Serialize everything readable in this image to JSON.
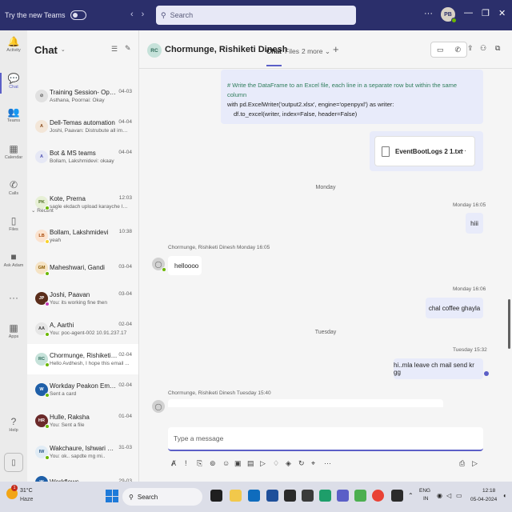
{
  "titlebar": {
    "try_label": "Try the new Teams",
    "search_placeholder": "Search",
    "more": "···",
    "user_initials": "PB"
  },
  "rail": [
    {
      "label": "Activity",
      "icon": "bell-icon",
      "glyph": "🔔"
    },
    {
      "label": "Chat",
      "icon": "chat-icon",
      "glyph": "💬",
      "active": true
    },
    {
      "label": "Teams",
      "icon": "teams-icon",
      "glyph": "👥"
    },
    {
      "label": "Calendar",
      "icon": "calendar-icon",
      "glyph": "▦"
    },
    {
      "label": "Calls",
      "icon": "phone-icon",
      "glyph": "✆"
    },
    {
      "label": "Files",
      "icon": "file-icon",
      "glyph": "▯"
    },
    {
      "label": "Ask Adam",
      "icon": "bot-icon",
      "glyph": "■"
    },
    {
      "label": "",
      "icon": "more-icon",
      "glyph": "···"
    },
    {
      "label": "Apps",
      "icon": "apps-icon",
      "glyph": "▦"
    },
    {
      "label": "Help",
      "icon": "help-icon",
      "glyph": "?"
    }
  ],
  "chatlist": {
    "title": "Chat",
    "recent_label": "Recent",
    "items": [
      {
        "initials": "⊘",
        "name": "Training Session- OpenCV",
        "time": "04-03",
        "preview": "Asthana, Poornai: Okay",
        "avatar_bg": "#e1e1e1",
        "avatar_fg": "#616161",
        "status": ""
      },
      {
        "initials": "A",
        "name": "Dell-Temas automation",
        "time": "04-04",
        "preview": "Joshi, Paavan: Distrubute all imag...",
        "avatar_bg": "#f3e6d8",
        "avatar_fg": "#8a4b1c",
        "status": ""
      },
      {
        "initials": "A",
        "name": "Bot & MS teams",
        "time": "04-04",
        "preview": "Bollam, Lakshmidevi: okaay",
        "avatar_bg": "#e6e8f5",
        "avatar_fg": "#4f52b2",
        "status": ""
      },
      {
        "initials": "PK",
        "name": "Kote, Prerna",
        "time": "12:03",
        "preview": "sagle ekdach upload karayche la...",
        "avatar_bg": "#e7f0d6",
        "avatar_fg": "#4a6b1c",
        "status": "#6bb700"
      },
      {
        "initials": "LB",
        "name": "Bollam, Lakshmidevi",
        "time": "10:38",
        "preview": "yeah",
        "avatar_bg": "#fbe3cf",
        "avatar_fg": "#a84b0c",
        "status": "#f8d22a"
      },
      {
        "initials": "GM",
        "name": "Maheshwari, Gandi",
        "time": "03-04",
        "preview": "",
        "avatar_bg": "#f5e3c4",
        "avatar_fg": "#8a5a00",
        "status": "#6bb700"
      },
      {
        "initials": "JP",
        "name": "Joshi, Paavan",
        "time": "03-04",
        "preview": "You: its working fine then",
        "avatar_bg": "#5a2d1a",
        "avatar_fg": "#ffffff",
        "status": "#c239b3"
      },
      {
        "initials": "AA",
        "name": "A, Aarthi",
        "time": "02-04",
        "preview": "You: poc-agent-002 10.91.237.17",
        "avatar_bg": "#e6e6e6",
        "avatar_fg": "#424242",
        "status": "#6bb700"
      },
      {
        "initials": "RC",
        "name": "Chormunge, Rishiketi Di...",
        "time": "02-04",
        "preview": "Hello Avdhesh, I hope this email ...",
        "avatar_bg": "#c6e2da",
        "avatar_fg": "#2e6b5a",
        "status": "#6bb700",
        "selected": true
      },
      {
        "initials": "W",
        "name": "Workday Peakon Employ...",
        "time": "02-04",
        "preview": "Sent a card",
        "avatar_bg": "#1f5fa8",
        "avatar_fg": "#ffffff",
        "status": "#6bb700"
      },
      {
        "initials": "HR",
        "name": "Hulle, Raksha",
        "time": "01-04",
        "preview": "You: Sent a file",
        "avatar_bg": "#6b2a2a",
        "avatar_fg": "#ffffff",
        "status": "#6bb700"
      },
      {
        "initials": "IW",
        "name": "Wakchaure, Ishwari Dnya...",
        "time": "31-03",
        "preview": "You: ok.. sapdte mg mi..",
        "avatar_bg": "#e1ecf5",
        "avatar_fg": "#2b5a8a",
        "status": "#6bb700"
      },
      {
        "initials": "W",
        "name": "Workflows",
        "time": "29-03",
        "preview": "",
        "avatar_bg": "#1f5fa8",
        "avatar_fg": "#ffffff",
        "status": ""
      }
    ]
  },
  "conversation": {
    "initials": "RC",
    "name": "Chormunge, Rishiketi Dinesh",
    "tabs": [
      "Chat",
      "Files",
      "2 more"
    ],
    "code_lines": [
      "# Write the DataFrame to an Excel file, each line in a separate row but within the same column",
      "with pd.ExcelWriter('output2.xlsx', engine='openpyxl') as writer:",
      "    df.to_excel(writer, index=False, header=False)"
    ],
    "file_name": "EventBootLogs 2 1.txt",
    "day_monday": "Monday",
    "day_tuesday": "Tuesday",
    "msg1_time": "Monday 16:05",
    "msg1_text": "hiii",
    "in1_meta": "Chormunge, Rishiketi Dinesh   Monday 16:05",
    "in1_text": "helloooo",
    "msg2_time": "Monday 16:06",
    "msg2_text": "chal coffee ghayla",
    "msg3_time": "Tuesday 15:32",
    "msg3_text": "hi..mla leave ch mail send kr gg",
    "in2_meta": "Chormunge, Rishiketi Dinesh   Tuesday 15:40",
    "compose_placeholder": "Type a message"
  },
  "taskbar": {
    "temp": "31°C",
    "condition": "Haze",
    "badge": "1",
    "search": "Search",
    "lang_top": "ENG",
    "lang_bottom": "IN",
    "time": "12:18",
    "date": "05-04-2024"
  }
}
